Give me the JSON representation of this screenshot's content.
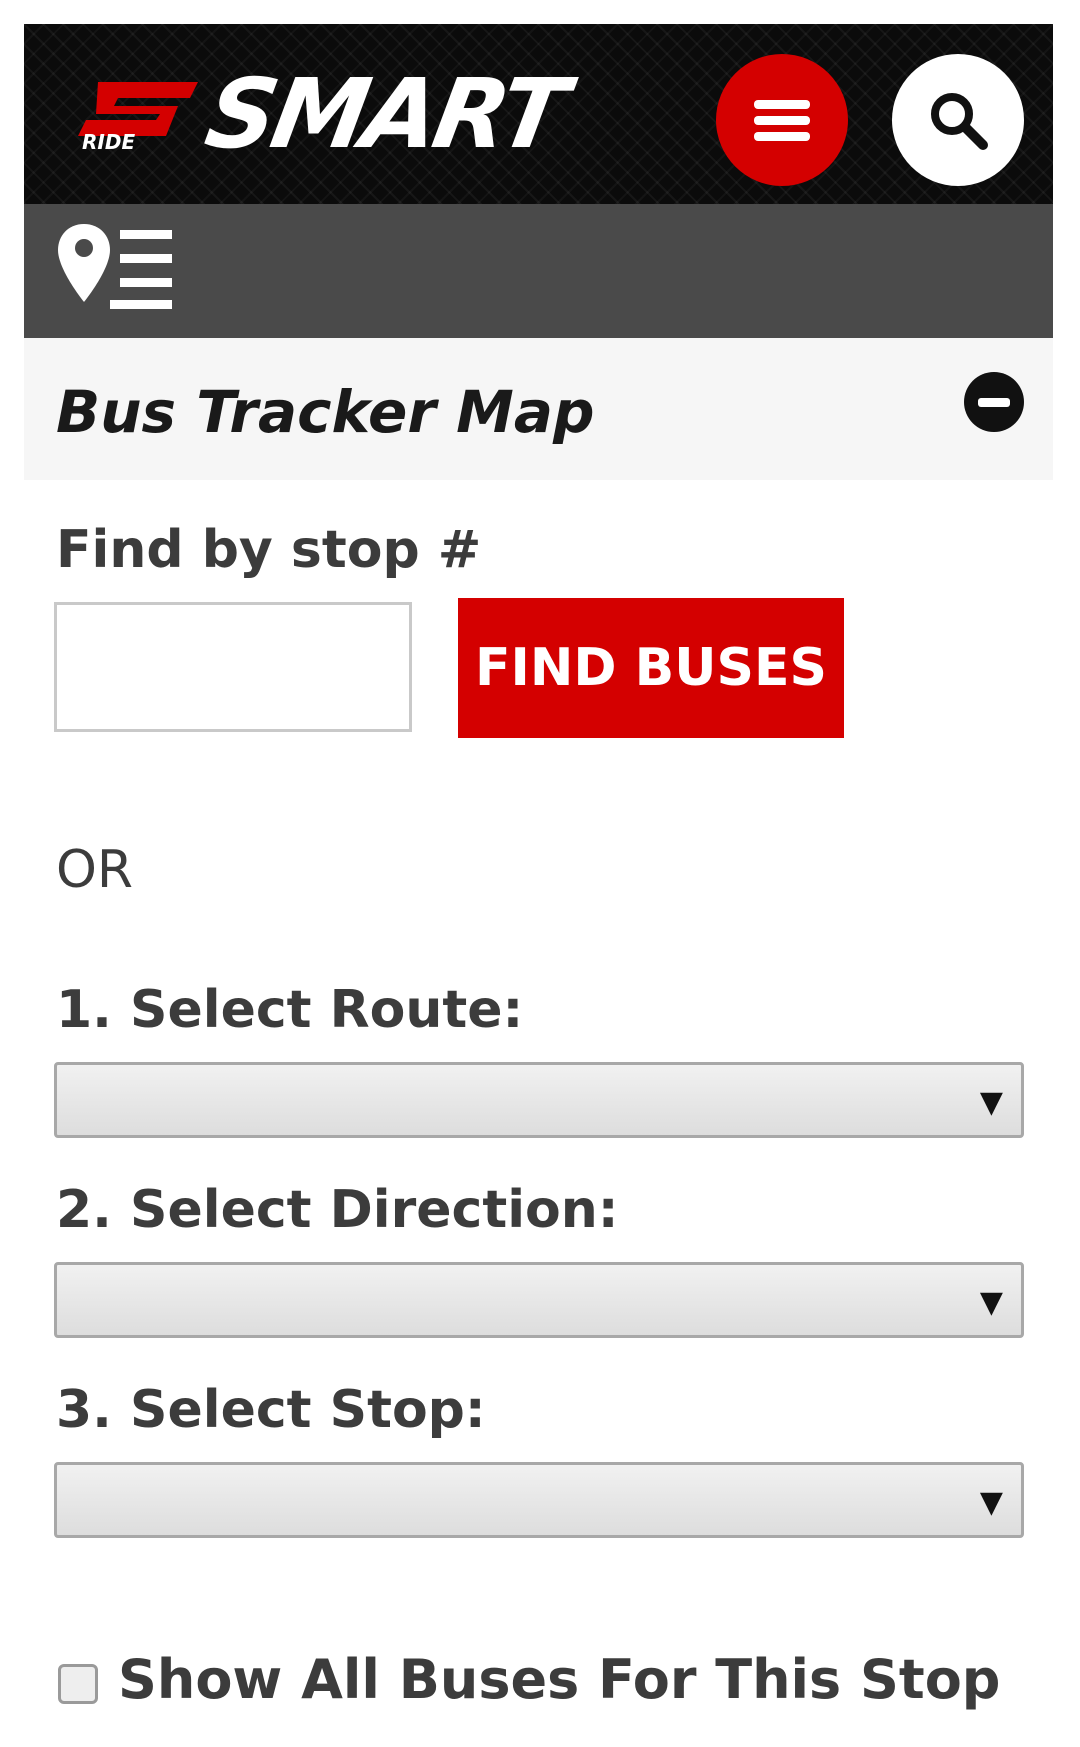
{
  "header": {
    "logo_word": "SMART",
    "logo_ride": "RIDE",
    "menu_icon": "hamburger-icon",
    "search_icon": "search-icon",
    "accent_color": "#d40000"
  },
  "subbar": {
    "icon": "location-list-icon"
  },
  "panel": {
    "title": "Bus Tracker Map",
    "toggle_icon": "minus-circle-icon"
  },
  "form": {
    "stop_label": "Find by stop #",
    "stop_value": "",
    "find_button": "FIND BUSES",
    "or_text": "OR",
    "route_label": "1. Select Route:",
    "route_value": "",
    "direction_label": "2. Select Direction:",
    "direction_value": "",
    "stop_select_label": "3. Select Stop:",
    "stop_select_value": "",
    "dropdown_arrow": "▼",
    "show_all_label": "Show All Buses For This Stop",
    "show_all_checked": false
  }
}
